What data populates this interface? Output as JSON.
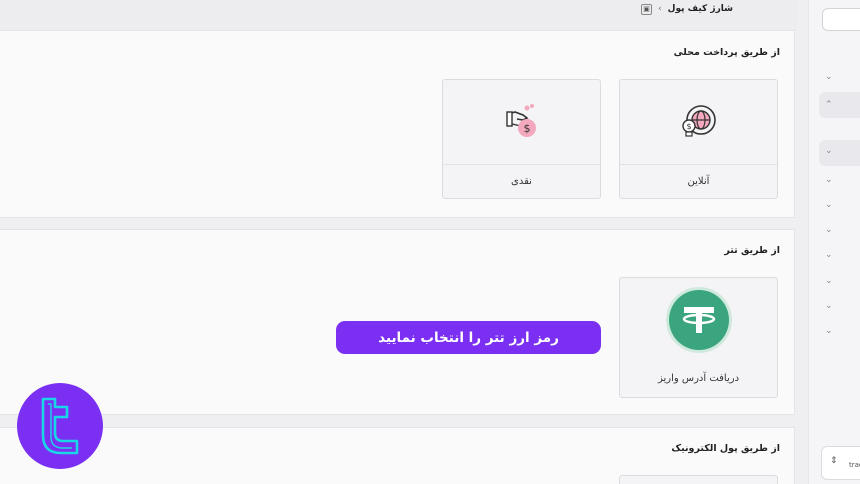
{
  "breadcrumb": {
    "label": "شارژ کیف پول"
  },
  "sections": [
    {
      "title": "از طریق پرداخت محلی",
      "cards": [
        {
          "label": "آنلاین",
          "icon": "online-payment-icon"
        },
        {
          "label": "نقدی",
          "icon": "cash-hand-icon"
        }
      ]
    },
    {
      "title": "از طریق تتر",
      "cards": [
        {
          "label": "دریافت آدرس واریز",
          "icon": "tether-icon"
        }
      ]
    },
    {
      "title": "از طریق پول الکترونیک"
    }
  ],
  "banner": {
    "text": "رمز ارز تتر را انتخاب نمایید"
  },
  "sidebar": {
    "footer_text": "trad"
  },
  "colors": {
    "accent": "#7b2ff2",
    "tether": "#3aa57e",
    "logo_line": "#19d6e6"
  }
}
